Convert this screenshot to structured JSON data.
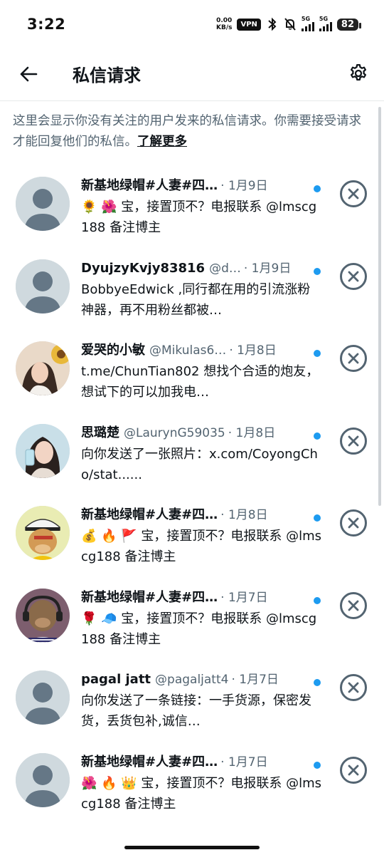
{
  "status_bar": {
    "time": "3:22",
    "net_speed_value": "0.00",
    "net_speed_unit": "KB/s",
    "vpn": "VPN",
    "net1": "5G",
    "net2": "5G",
    "battery": "82"
  },
  "header": {
    "title": "私信请求",
    "back_icon": "arrow-left-icon",
    "settings_icon": "gear-icon"
  },
  "notice": {
    "text": "这里会显示你没有关注的用户发来的私信请求。你需要接受请求才能回复他们的私信。",
    "link": "了解更多"
  },
  "colors": {
    "accent": "#1d9bf0",
    "secondary_text": "#536471",
    "primary_text": "#0f1419"
  },
  "requests": [
    {
      "name": "新基地绿帽#人妻#四…",
      "handle": "",
      "date": "· 1月9日",
      "message": "🌻 🌺 宝，接置顶不？电报联系 @lmscg188   备注博主",
      "avatar": "default",
      "unread": true
    },
    {
      "name": "DyujzyKvjy83816",
      "handle": "@d…",
      "date": "· 1月9日",
      "message": "BobbyeEdwick ,同行都在用的引流涨粉神器，再不用粉丝都被…",
      "avatar": "default",
      "unread": true
    },
    {
      "name": "爱哭的小敏",
      "handle": "@Mikulas6…",
      "date": "· 1月8日",
      "message": "t.me/ChunTian802 想找个合适的炮友，想试下的可以加我电…",
      "avatar": "photo-girl-sunflower",
      "unread": true
    },
    {
      "name": "思璐楚",
      "handle": "@LaurynG59035",
      "date": "· 1月8日",
      "message": "向你发送了一张照片：x.com/CoyongCho/stat......",
      "avatar": "photo-girl-drink",
      "unread": true
    },
    {
      "name": "新基地绿帽#人妻#四…",
      "handle": "",
      "date": "· 1月8日",
      "message": "💰 🔥 🚩 宝，接置顶不？电报联系 @lmscg188   备注博主",
      "avatar": "ape-captain",
      "unread": true
    },
    {
      "name": "新基地绿帽#人妻#四…",
      "handle": "",
      "date": "· 1月7日",
      "message": "🌹 🧢 宝，接置顶不？电报联系 @lmscg188   备注博主",
      "avatar": "ape-headphones",
      "unread": true
    },
    {
      "name": "pagal jatt",
      "handle": "@pagaljatt4",
      "date": "· 1月7日",
      "message": "向你发送了一条链接：一手货源，保密发货，丢货包补,诚信…",
      "avatar": "default",
      "unread": true
    },
    {
      "name": "新基地绿帽#人妻#四…",
      "handle": "",
      "date": "· 1月7日",
      "message": "🌺 🔥 👑 宝，接置顶不？电报联系 @lmscg188   备注博主",
      "avatar": "default",
      "unread": true
    }
  ]
}
